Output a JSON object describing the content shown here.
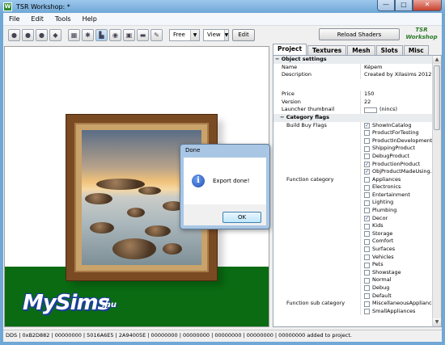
{
  "window": {
    "title": "TSR Workshop: *",
    "min": "—",
    "max": "□",
    "close": "✕"
  },
  "menu": [
    "File",
    "Edit",
    "Tools",
    "Help"
  ],
  "toolbar": {
    "mode_value": "Free",
    "view_value": "View",
    "edit_label": "Edit",
    "reload_label": "Reload Shaders",
    "logo_text": "TSR Workshop"
  },
  "tabs": [
    {
      "label": "Project"
    },
    {
      "label": "Textures"
    },
    {
      "label": "Mesh"
    },
    {
      "label": "Slots"
    },
    {
      "label": "Misc"
    }
  ],
  "properties": {
    "section_object": "Object settings",
    "name_key": "Name",
    "name_val": "Képem",
    "desc_key": "Description",
    "desc_val": "Created by Xilasims 2012",
    "price_key": "Price",
    "price_val": "150",
    "version_key": "Version",
    "version_val": "22",
    "thumb_key": "Launcher thumbnail",
    "thumb_val": "(nincs)",
    "section_category": "Category flags",
    "buy_key": "Build Buy Flags",
    "buy_flags": [
      {
        "label": "ShowInCatalog",
        "checked": true
      },
      {
        "label": "ProductForTesting",
        "checked": false
      },
      {
        "label": "ProductInDevelopment",
        "checked": false
      },
      {
        "label": "ShippingProduct",
        "checked": false
      },
      {
        "label": "DebugProduct",
        "checked": false
      },
      {
        "label": "ProductionProduct",
        "checked": true
      },
      {
        "label": "ObjProductMadeUsing...",
        "checked": true
      }
    ],
    "func_key": "Function category",
    "func_flags": [
      {
        "label": "Appliances",
        "checked": false
      },
      {
        "label": "Electronics",
        "checked": false
      },
      {
        "label": "Entertainment",
        "checked": false
      },
      {
        "label": "Lighting",
        "checked": false
      },
      {
        "label": "Plumbing",
        "checked": false
      },
      {
        "label": "Decor",
        "checked": true
      },
      {
        "label": "Kids",
        "checked": false
      },
      {
        "label": "Storage",
        "checked": false
      },
      {
        "label": "Comfort",
        "checked": false
      },
      {
        "label": "Surfaces",
        "checked": false
      },
      {
        "label": "Vehicles",
        "checked": false
      },
      {
        "label": "Pets",
        "checked": false
      },
      {
        "label": "Showstage",
        "checked": false
      },
      {
        "label": "Normal",
        "checked": false
      },
      {
        "label": "Debug",
        "checked": false
      },
      {
        "label": "Default",
        "checked": false
      }
    ],
    "funcsub_key": "Function sub category",
    "funcsub_flags": [
      {
        "label": "MiscellaneousAppliances",
        "checked": false
      },
      {
        "label": "SmallAppliances",
        "checked": false
      }
    ]
  },
  "dialog": {
    "title": "Done",
    "message": "Export done!",
    "ok_label": "OK"
  },
  "watermark": {
    "main": "MySims",
    "suffix": ".hu"
  },
  "status": "DDS | 0xB2D882 | 00000000 | 5016A6E5 | 2A94005E | 00000000 | 00000000 | 00000000 | 00000000 | 00000000 added to project."
}
